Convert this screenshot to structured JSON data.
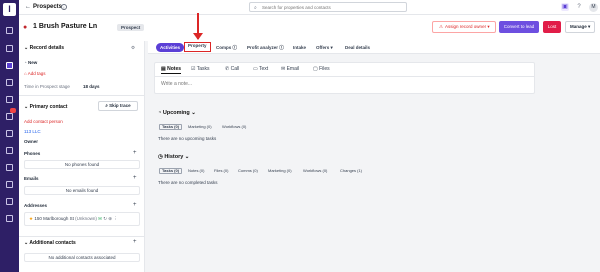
{
  "topbar": {
    "back_glyph": "←",
    "title": "Prospects",
    "info_glyph": "i",
    "search_placeholder": "Search for properties and contacts",
    "avatar_initial": "M"
  },
  "header": {
    "address": "1 Brush Pasture Ln",
    "status_chip": "Prospect",
    "assign_label": "Assign record owner",
    "convert_label": "Convert to lead",
    "lost_label": "Lost",
    "manage_label": "Manage"
  },
  "record_tabs": [
    "Activities",
    "Property",
    "Comps",
    "Profit analyzer",
    "Intake",
    "Offers",
    "Deal details"
  ],
  "sidebar": {
    "record_details_title": "Record details",
    "stage": "New",
    "add_tags": "Add tags",
    "time_in_stage_label": "Time in Prospect stage",
    "time_in_stage_value": "18 days",
    "primary_contact_title": "Primary contact",
    "skip_trace_label": "Skip trace",
    "add_contact_person": "Add contact person",
    "company": "113 LLC",
    "owner_label": "Owner",
    "phones_label": "Phones",
    "no_phones": "No phones found",
    "emails_label": "Emails",
    "no_emails": "No emails found",
    "addresses_label": "Addresses",
    "address_item": "150 Marlborough St",
    "address_status": "(Unknown)",
    "additional_contacts_title": "Additional contacts",
    "no_additional": "No additional contacts associated"
  },
  "composer": {
    "tabs": [
      "Notes",
      "Tasks",
      "Call",
      "Text",
      "Email",
      "Files"
    ],
    "placeholder": "Write a note..."
  },
  "upcoming": {
    "title": "Upcoming",
    "pills": [
      "Tasks (0)",
      "Marketing (0)",
      "Workflows (0)"
    ],
    "empty": "There are no upcoming tasks"
  },
  "history": {
    "title": "History",
    "pills": [
      "Tasks (0)",
      "Notes (0)",
      "Files (0)",
      "Comms (0)",
      "Marketing (0)",
      "Workflows (0)",
      "Changes (1)"
    ],
    "empty": "There are no completed tasks"
  },
  "colors": {
    "nav_bg": "#2e1f66",
    "accent": "#5b3fd6",
    "danger": "#e11d48",
    "annotation": "#dc2626"
  }
}
